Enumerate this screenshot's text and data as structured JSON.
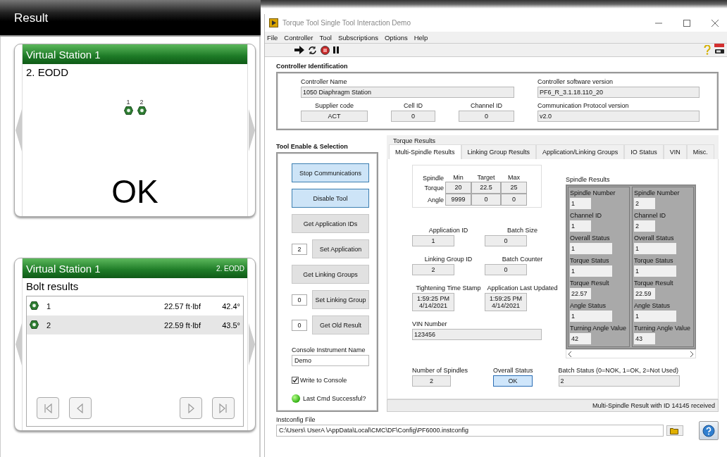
{
  "result_panel": {
    "title": "Result",
    "station_card": {
      "title": "Virtual Station 1",
      "program": "2. EODD",
      "bolts": [
        {
          "label": "1"
        },
        {
          "label": "2"
        }
      ],
      "status": "OK"
    },
    "bolt_card": {
      "title": "Virtual Station 1",
      "program": "2. EODD",
      "heading": "Bolt results",
      "rows": [
        {
          "bolt": "1",
          "torque": "22.57 ft·lbf",
          "angle": "42.4°",
          "selected": false
        },
        {
          "bolt": "2",
          "torque": "22.59 ft·lbf",
          "angle": "43.5°",
          "selected": true
        }
      ]
    }
  },
  "window": {
    "title": "Torque Tool Single Tool Interaction Demo",
    "menu": [
      "File",
      "Controller",
      "Tool",
      "Subscriptions",
      "Options",
      "Help"
    ],
    "controller_identification": {
      "title": "Controller Identification",
      "fields": [
        {
          "label": "Controller Name",
          "value": "1050 Diaphragm Station"
        },
        {
          "label": "Controller software version",
          "value": "PF6_R_3.1.18.110_20"
        },
        {
          "label": "Supplier code",
          "value": "ACT"
        },
        {
          "label": "Cell ID",
          "value": "0"
        },
        {
          "label": "Channel ID",
          "value": "0"
        },
        {
          "label": "Communication Protocol version",
          "value": "v2.0"
        }
      ]
    },
    "tool_enable": {
      "title": "Tool Enable & Selection",
      "controls": [
        {
          "kind": "button",
          "label": "Stop Communications",
          "pressed": true
        },
        {
          "kind": "button",
          "label": "Disable Tool",
          "pressed": true
        },
        {
          "kind": "button",
          "label": "Get Application IDs",
          "pressed": false
        },
        {
          "kind": "input_button",
          "value": "2",
          "label": "Set Application",
          "pressed": false
        },
        {
          "kind": "button",
          "label": "Get Linking Groups",
          "pressed": false
        },
        {
          "kind": "input_button",
          "value": "0",
          "label": "Set Linking Group",
          "pressed": false
        },
        {
          "kind": "input_button",
          "value": "0",
          "label": "Get Old Result",
          "pressed": false
        }
      ],
      "console_name": {
        "label": "Console Instrument Name",
        "value": "Demo"
      },
      "write_to_console": {
        "label": "Write to Console",
        "checked": true
      },
      "last_cmd": {
        "label": "Last Cmd Successful?",
        "on": true
      }
    },
    "torque_results": {
      "title": "Torque Results",
      "tabs": [
        {
          "label": "Multi-Spindle Results",
          "selected": true
        },
        {
          "label": "Linking Group Results",
          "selected": false
        },
        {
          "label": "Application/Linking Groups",
          "selected": false
        },
        {
          "label": "IO Status",
          "selected": false
        },
        {
          "label": "VIN",
          "selected": false
        },
        {
          "label": "Misc.",
          "selected": false
        }
      ],
      "limits": {
        "corner": "Spindle",
        "columns": [
          "Min",
          "Target",
          "Max"
        ],
        "rows": [
          {
            "label": "Torque",
            "values": [
              "20",
              "22.5",
              "25"
            ]
          },
          {
            "label": "Angle",
            "values": [
              "9999",
              "0",
              "0"
            ]
          }
        ]
      },
      "field_pairs": [
        [
          {
            "label": "Application ID",
            "value": "1"
          },
          {
            "label": "Batch Size",
            "value": "0"
          }
        ],
        [
          {
            "label": "Linking Group ID",
            "value": "2"
          },
          {
            "label": "Batch Counter",
            "value": "0"
          }
        ],
        [
          {
            "label": "Tightening Time Stamp",
            "value": "1:59:25 PM\n4/14/2021"
          },
          {
            "label": "Application Last Updated",
            "value": "1:59:25 PM\n4/14/2021"
          }
        ]
      ],
      "vin": {
        "label": "VIN Number",
        "value": "123456"
      },
      "spindle_results": {
        "title": "Spindle Results",
        "spindles": [
          {
            "fields": [
              {
                "label": "Spindle Number",
                "value": "1"
              },
              {
                "label": "Channel ID",
                "value": "1"
              },
              {
                "label": "Overall Status",
                "value": "1"
              },
              {
                "label": "Torque Status",
                "value": "1"
              },
              {
                "label": "Torque Result",
                "value": "22.57"
              },
              {
                "label": "Angle Status",
                "value": "1"
              },
              {
                "label": "Turning Angle Value",
                "value": "42"
              }
            ]
          },
          {
            "fields": [
              {
                "label": "Spindle Number",
                "value": "2"
              },
              {
                "label": "Channel ID",
                "value": "2"
              },
              {
                "label": "Overall Status",
                "value": "1"
              },
              {
                "label": "Torque Status",
                "value": "1"
              },
              {
                "label": "Torque Result",
                "value": "22.59"
              },
              {
                "label": "Angle Status",
                "value": "1"
              },
              {
                "label": "Turning Angle Value",
                "value": "43"
              }
            ]
          }
        ]
      },
      "summary": [
        {
          "label": "Number of Spindles",
          "value": "2",
          "highlighted": false
        },
        {
          "label": "Overall Status",
          "value": "OK",
          "highlighted": true
        },
        {
          "label": "Batch Status (0=NOK, 1=OK, 2=Not Used)",
          "value": "2",
          "highlighted": false
        }
      ],
      "status_bar": "Multi-Spindle Result with ID 14145 received"
    },
    "instconfig": {
      "label": "Instconfig File",
      "value": "C:\\Users\\ UserA \\AppData\\Local\\CMC\\DF\\Config\\PF6000.instconfig"
    }
  }
}
